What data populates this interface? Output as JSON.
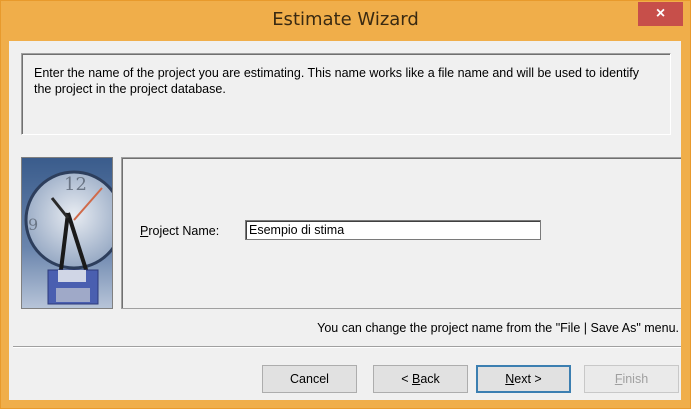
{
  "window": {
    "title": "Estimate Wizard",
    "close_glyph": "×"
  },
  "description": "Enter the name of the project you are estimating. This name works like a file name and will be used to identify the project in the project database.",
  "form": {
    "label_accel": "P",
    "label_rest": "roject Name:",
    "value": "Esempio di stima"
  },
  "hint": "You can change the project name from the \"File | Save As\" menu.",
  "buttons": {
    "cancel": "Cancel",
    "back_prefix": "< ",
    "back_accel": "B",
    "back_rest": "ack",
    "next_accel": "N",
    "next_rest": "ext >",
    "finish_accel": "F",
    "finish_rest": "inish"
  },
  "colors": {
    "title_bar": "#f0ae4a",
    "close_button": "#c74f4a",
    "default_button_border": "#3c7fb1"
  },
  "icons": {
    "side_graphic": "clock-with-compass-and-floppy-disk"
  }
}
